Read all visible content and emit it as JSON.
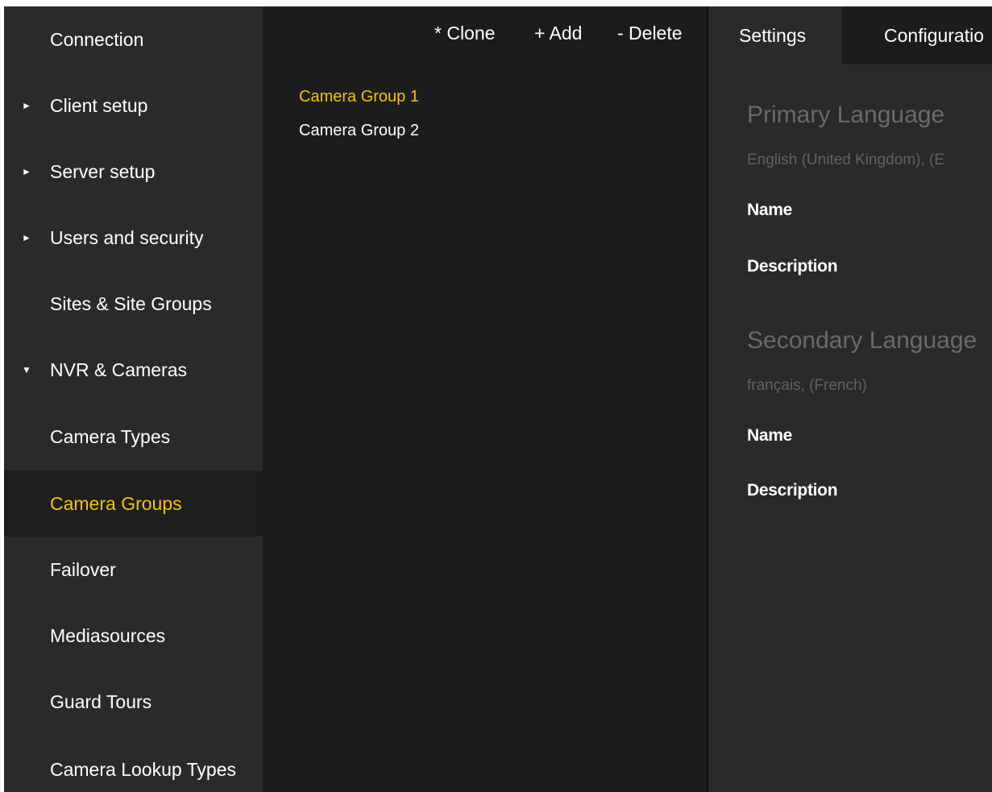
{
  "sidebar": {
    "items": [
      {
        "label": "Connection",
        "arrow": ""
      },
      {
        "label": "Client setup",
        "arrow": "►"
      },
      {
        "label": "Server setup",
        "arrow": "►"
      },
      {
        "label": "Users and security",
        "arrow": "►"
      },
      {
        "label": "Sites & Site Groups",
        "arrow": ""
      },
      {
        "label": "NVR & Cameras",
        "arrow": "▼"
      },
      {
        "label": "Camera Types",
        "arrow": ""
      },
      {
        "label": "Camera Groups",
        "arrow": ""
      },
      {
        "label": "Failover",
        "arrow": ""
      },
      {
        "label": "Mediasources",
        "arrow": ""
      },
      {
        "label": "Guard Tours",
        "arrow": ""
      },
      {
        "label": "Camera Lookup Types",
        "arrow": ""
      }
    ],
    "active_index": 7
  },
  "toolbar": {
    "clone_label": "* Clone",
    "add_label": "+ Add",
    "delete_label": "- Delete"
  },
  "groups": {
    "items": [
      "Camera Group 1",
      "Camera Group 2"
    ],
    "selected_index": 0
  },
  "details": {
    "tabs": [
      "Settings",
      "Configuratio"
    ],
    "primary": {
      "title": "Primary Language",
      "language": "English (United Kingdom), (E",
      "name_label": "Name",
      "description_label": "Description"
    },
    "secondary": {
      "title": "Secondary Language",
      "language": "français, (French)",
      "name_label": "Name",
      "description_label": "Description"
    }
  },
  "colors": {
    "accent": "#f4c400",
    "sidebar_bg": "#2a2a2a",
    "panel_bg": "#1c1c1c",
    "muted_text": "#6a6a6a"
  }
}
